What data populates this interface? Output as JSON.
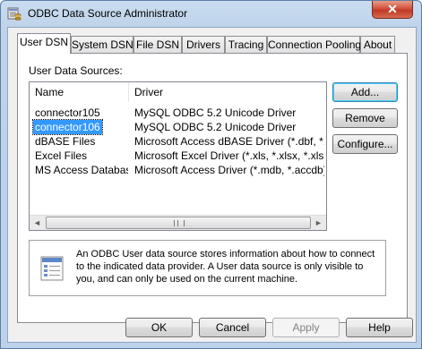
{
  "window": {
    "title": "ODBC Data Source Administrator",
    "close_glyph": "✕"
  },
  "tabs": [
    {
      "label": "User DSN",
      "active": true
    },
    {
      "label": "System DSN"
    },
    {
      "label": "File DSN"
    },
    {
      "label": "Drivers"
    },
    {
      "label": "Tracing"
    },
    {
      "label": "Connection Pooling"
    },
    {
      "label": "About"
    }
  ],
  "main": {
    "list_label": "User Data Sources:",
    "columns": [
      "Name",
      "Driver"
    ],
    "rows": [
      {
        "name": "connector105",
        "driver": "MySQL ODBC 5.2 Unicode Driver",
        "selected": false
      },
      {
        "name": "connector106",
        "driver": "MySQL ODBC 5.2 Unicode Driver",
        "selected": true
      },
      {
        "name": "dBASE Files",
        "driver": "Microsoft Access dBASE Driver (*.dbf, *.ndx",
        "selected": false
      },
      {
        "name": "Excel Files",
        "driver": "Microsoft Excel Driver (*.xls, *.xlsx, *.xlsm, *.x",
        "selected": false
      },
      {
        "name": "MS Access Database",
        "driver": "Microsoft Access Driver (*.mdb, *.accdb)",
        "selected": false
      }
    ],
    "scroll_left": "◄",
    "scroll_right": "►"
  },
  "side_buttons": {
    "add": "Add...",
    "remove": "Remove",
    "configure": "Configure..."
  },
  "info": {
    "text": "An ODBC User data source stores information about how to connect to the indicated data provider.  A User data source is only visible to you, and can only be used on the current machine."
  },
  "footer": {
    "ok": "OK",
    "cancel": "Cancel",
    "apply": "Apply",
    "help": "Help"
  },
  "colors": {
    "selection": "#3399ff",
    "default_button_glow": "#48d2fb",
    "title_bar": "#bcd2ea"
  }
}
